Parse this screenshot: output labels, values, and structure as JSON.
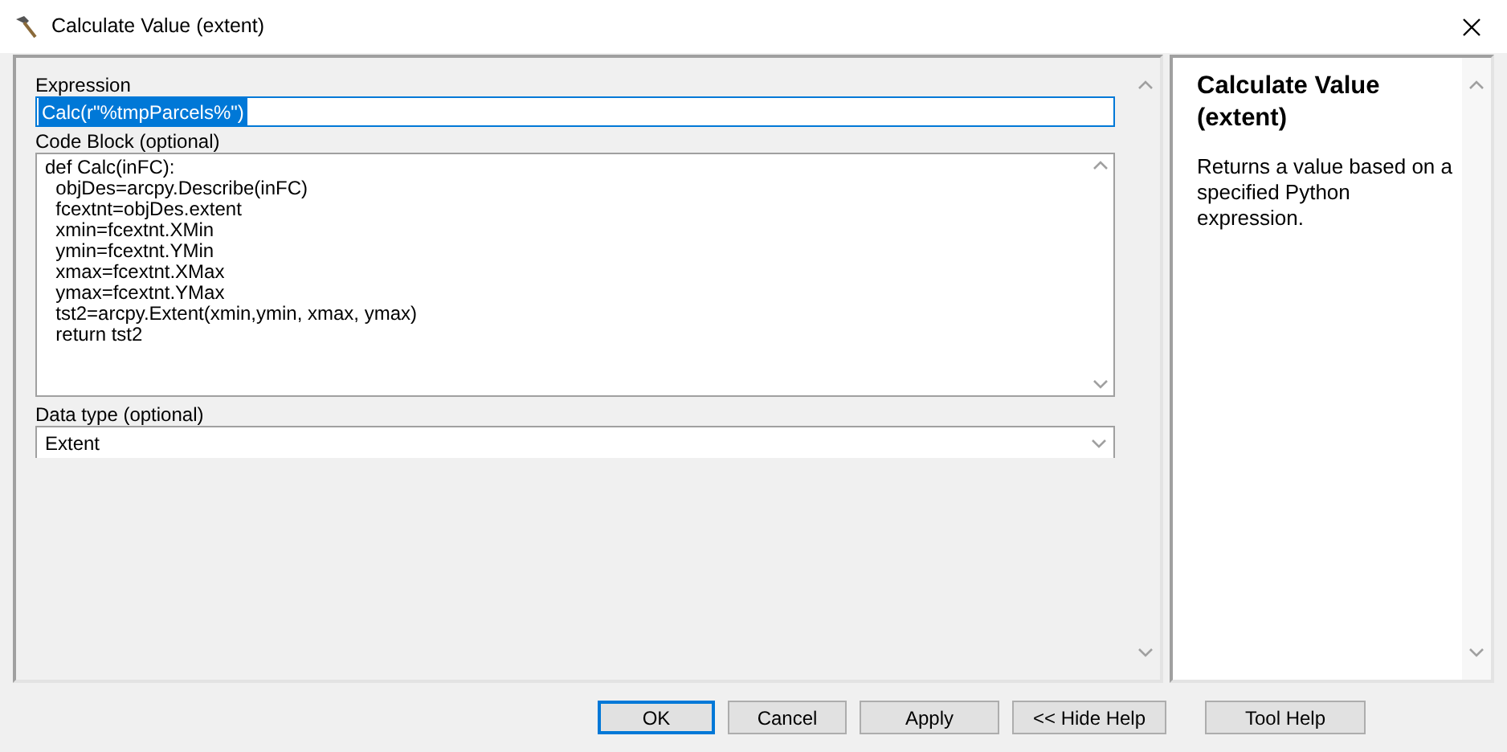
{
  "window": {
    "title": "Calculate Value (extent)"
  },
  "expression": {
    "label": "Expression",
    "value": "Calc(r\"%tmpParcels%\")",
    "selected": true
  },
  "code_block": {
    "label": "Code Block (optional)",
    "lines": [
      "def Calc(inFC):",
      "  objDes=arcpy.Describe(inFC)",
      "  fcextnt=objDes.extent",
      "  xmin=fcextnt.XMin",
      "  ymin=fcextnt.YMin",
      "  xmax=fcextnt.XMax",
      "  ymax=fcextnt.YMax",
      "  tst2=arcpy.Extent(xmin,ymin, xmax, ymax)",
      "  return tst2"
    ]
  },
  "data_type": {
    "label": "Data type (optional)",
    "value": "Extent"
  },
  "help": {
    "title": "Calculate Value (extent)",
    "text": "Returns a value based on a specified Python expression."
  },
  "buttons": [
    {
      "label": "OK",
      "default": true
    },
    {
      "label": "Cancel",
      "default": false
    },
    {
      "label": "Apply",
      "default": false
    },
    {
      "label": "<< Hide Help",
      "default": false
    },
    {
      "label": "Tool Help",
      "default": false
    }
  ]
}
